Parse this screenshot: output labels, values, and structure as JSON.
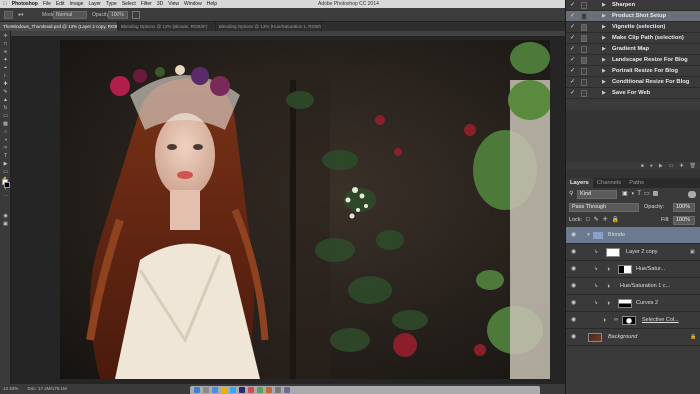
{
  "menubar": {
    "app": "Photoshop",
    "items": [
      "File",
      "Edit",
      "Image",
      "Layer",
      "Type",
      "Select",
      "Filter",
      "3D",
      "View",
      "Window",
      "Help"
    ],
    "title": "Adobe Photoshop CC 2014"
  },
  "options": {
    "mode_label": "Mode:",
    "mode_value": "Normal",
    "opacity_label": "Opacity:",
    "opacity_value": "100%"
  },
  "document_tabs": [
    "TheWindows_Thumbnail.psd @ 13% (Layer 2 copy, RGB/8*)",
    "Blending Options @ 13% (Blonde, RGB/8*)",
    "Blending Options @ 13% (Hue/Saturation 1, RGB/8*)"
  ],
  "status": {
    "zoom": "13.33%",
    "doc": "Doc: 17.4M/178.1M"
  },
  "actions": [
    {
      "label": "Sharpen",
      "checked": true,
      "dialog": false,
      "selected": false
    },
    {
      "label": "Product Shot Setup",
      "checked": true,
      "dialog": false,
      "selected": true
    },
    {
      "label": "Vignette (selection)",
      "checked": true,
      "dialog": true,
      "selected": false
    },
    {
      "label": "Make Clip Path (selection)",
      "checked": true,
      "dialog": true,
      "selected": false
    },
    {
      "label": "Gradient Map",
      "checked": true,
      "dialog": false,
      "selected": false
    },
    {
      "label": "Landscape Resize For Blog",
      "checked": true,
      "dialog": true,
      "selected": false
    },
    {
      "label": "Portrait Resize For Blog",
      "checked": true,
      "dialog": false,
      "selected": false
    },
    {
      "label": "Conditional Resize For Blog",
      "checked": true,
      "dialog": false,
      "selected": false
    },
    {
      "label": "Save For Web",
      "checked": true,
      "dialog": false,
      "selected": false
    }
  ],
  "layers_panel": {
    "tabs": [
      "Layers",
      "Channels",
      "Paths"
    ],
    "filter_kind": "Kind",
    "blend_mode": "Pass Through",
    "opacity_label": "Opacity:",
    "opacity_value": "100%",
    "lock_label": "Lock:",
    "fill_label": "Fill:",
    "fill_value": "100%",
    "layers": [
      {
        "name": "Blonde",
        "type": "group",
        "selected": true
      },
      {
        "name": "Layer 2 copy",
        "type": "pixel",
        "selected": false
      },
      {
        "name": "Hue/Satur...",
        "type": "adjustment",
        "selected": false
      },
      {
        "name": "Hue/Saturation 1 c...",
        "type": "adjustment",
        "selected": false
      },
      {
        "name": "Curves 2",
        "type": "adjustment",
        "selected": false
      },
      {
        "name": "Selective Col...",
        "type": "adjustment",
        "selected": false
      },
      {
        "name": "Background",
        "type": "background",
        "selected": false
      }
    ]
  },
  "colors": {
    "selection": "#6b7a8f",
    "panel": "#3a3a3a",
    "menubar": "#d8d8d8"
  }
}
